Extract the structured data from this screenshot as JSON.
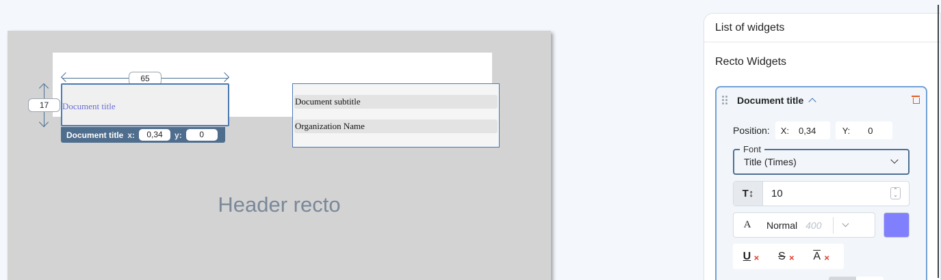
{
  "canvas": {
    "dimension_width": "65",
    "dimension_height": "17",
    "selected_widget_text": "Document title",
    "toolbar": {
      "name": "Document title",
      "x_label": "x:",
      "x_value": "0,34",
      "y_label": "y:",
      "y_value": "0"
    },
    "subtitle_text": "Document subtitle",
    "organization_text": "Organization Name",
    "section_label": "Header recto"
  },
  "panel": {
    "title": "List of widgets",
    "section": "Recto Widgets",
    "widget": {
      "name": "Document title",
      "position_label": "Position:",
      "x_label": "X:",
      "x_value": "0,34",
      "y_label": "Y:",
      "y_value": "0",
      "font_legend": "Font",
      "font_value": "Title (Times)",
      "size_icon": "T↕",
      "size_value": "10",
      "weight_icon": "A",
      "weight_name": "Normal",
      "weight_value": "400",
      "text_color": "#8080ff",
      "decorations": [
        "U",
        "S",
        "A"
      ],
      "decoration_x": "×"
    }
  },
  "colors": {
    "accent": "#4a78b4",
    "delete": "#e05a1e",
    "remove": "#e23b2a"
  }
}
